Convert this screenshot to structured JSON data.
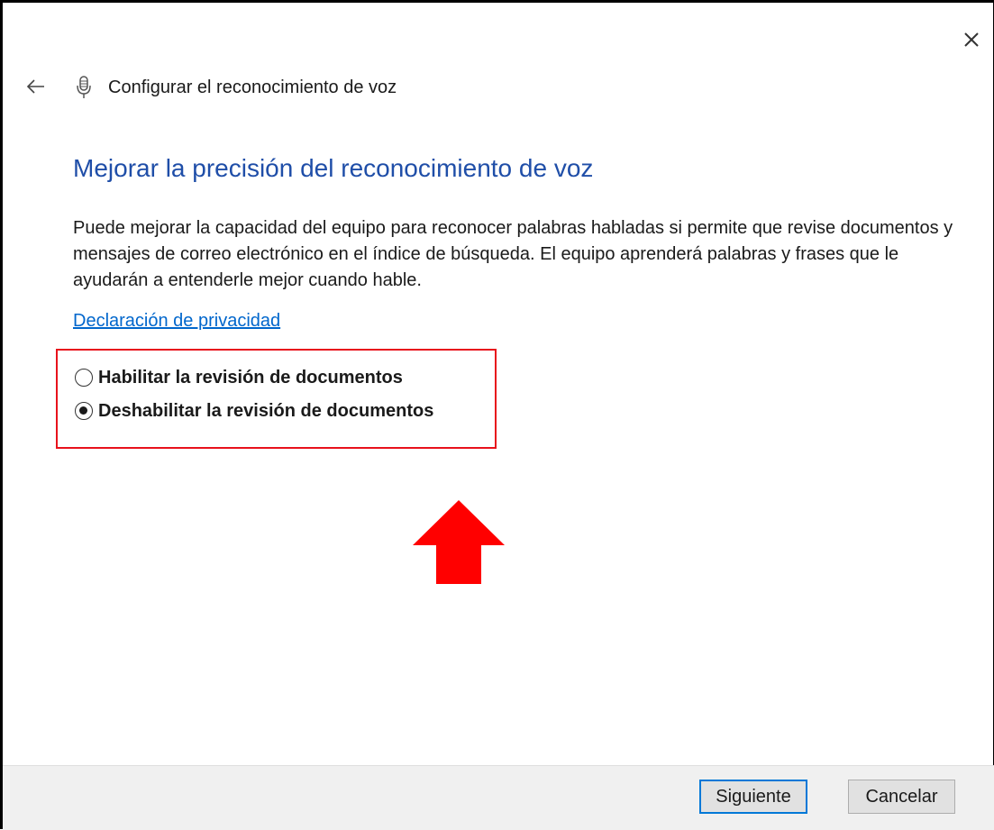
{
  "window": {
    "title": "Configurar el reconocimiento de voz"
  },
  "content": {
    "heading": "Mejorar la precisión del reconocimiento de voz",
    "description": "Puede mejorar la capacidad del equipo para reconocer palabras habladas si permite que revise documentos y mensajes de correo electrónico en el índice de búsqueda. El equipo aprenderá palabras y frases que le ayudarán a entenderle mejor cuando hable.",
    "privacy_link": "Declaración de privacidad",
    "options": [
      {
        "label": "Habilitar la revisión de documentos",
        "selected": false
      },
      {
        "label": "Deshabilitar la revisión de documentos",
        "selected": true
      }
    ]
  },
  "footer": {
    "next_label": "Siguiente",
    "cancel_label": "Cancelar"
  },
  "annotations": {
    "highlight_color": "#e8121c",
    "arrow_color": "#ff0000"
  },
  "icons": {
    "close": "close-icon",
    "back": "back-arrow-icon",
    "mic": "microphone-icon"
  },
  "colors": {
    "heading": "#1f4ea8",
    "link": "#0066cc",
    "primary_button_border": "#0078d7",
    "footer_background": "#f0f0f0"
  }
}
